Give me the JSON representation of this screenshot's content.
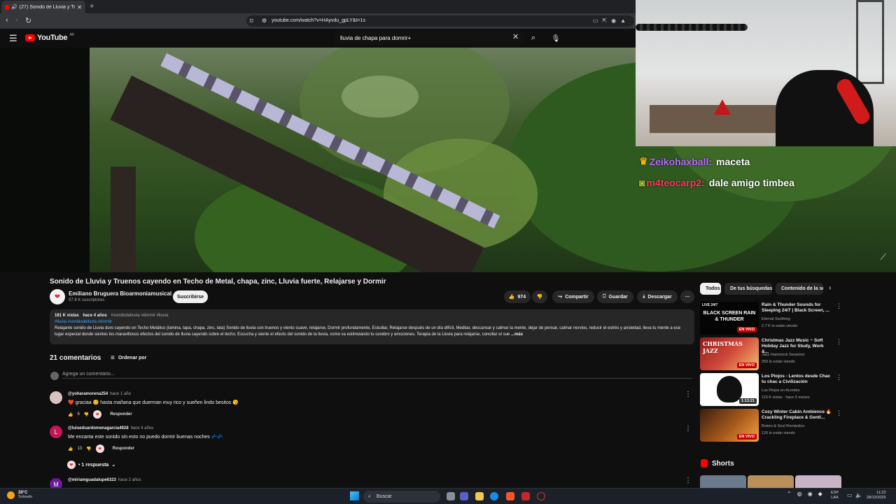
{
  "browser": {
    "tab_title": "(27) Sonido de Lluvia y Truen",
    "url": "youtube.com/watch?v=HAyvdu_gpLY&t=1s"
  },
  "youtube": {
    "logo_text": "YouTube",
    "logo_region": "AR",
    "search_value": "lluvia de chapa para domrir+"
  },
  "stream_chat": [
    {
      "user": "Zeikohaxball:",
      "message": "maceta",
      "user_color": "#b76cff"
    },
    {
      "user": "m4teocarp2:",
      "message": "dale amigo timbea",
      "user_color": "#ff3b5c"
    }
  ],
  "video": {
    "title": "Sonido de Lluvia y Truenos cayendo en Techo de Metal, chapa, zinc, Lluvia fuerte, Relajarse y Dormir",
    "channel": "Emiliano Bruguera Bioarmoniamusical",
    "subscribers": "97.8 K suscriptores",
    "subscribe_label": "Suscribirse",
    "likes": "974",
    "share_label": "Compartir",
    "save_label": "Guardar",
    "download_label": "Descargar"
  },
  "description": {
    "views": "181 K vistas",
    "age": "hace 4 años",
    "header_tags": "#sonidodelluvia #dormir #lluvia",
    "tags": "#lluvia #sonidodelluvia #dormir",
    "text": "Relajante sonido de Lluvia duro cayendo en Techo Metálico (lamina, tapa, chapa, zinc, lata) Sonido de lluvia con truenos y viento suave, relajarse, Dormir profundamente, Estudiar, Relajarse después de un día difícil, Meditar, descansar y calmar la mente, dejar de pensar, calmar nervios,  reducir el estrés y ansiedad, lleva tu mente a ese lugar especial donde sientes los maravillosos efectos del sonido de lluvia cayendo sobre el techo. Escucha y siente el efecto del sonido de la lluvia, como va estimulando tu cerebro y emociones. Terapia de la Lluvia para relajarse, conciliar el sue",
    "more_label": "...más"
  },
  "comments": {
    "count_label": "21 comentarios",
    "sort_label": "Ordenar por",
    "add_placeholder": "Agrega un comentario...",
    "reply_label": "Responder",
    "items": [
      {
        "user": "@yoharamorena254",
        "time": "hace 1 año",
        "text": "❤️ graciaa 😊 hasta mañana que duerman muy rico y sueñen lindo besitos 😘",
        "likes": "6"
      },
      {
        "user": "@luiseduardomenagarcia4928",
        "time": "hace 4 años",
        "text": "Me encanta este sonido sin esto no puedo dormir buenas noches 💤💤",
        "likes": "13"
      },
      {
        "user": "@miriamguadalupe6323",
        "time": "hace 2 años",
        "text": ""
      }
    ],
    "replies_label": "• 1 respuesta"
  },
  "sidebar": {
    "chips": [
      "Todos",
      "De tus búsquedas",
      "Contenido de la se"
    ],
    "recommendations": [
      {
        "title": "Rain & Thunder Sounds for Sleeping 24/7 | Black Screen, ...",
        "channel": "Eternal Soothing",
        "meta": "2.7 K lo están viendo",
        "badge": "EN VIVO",
        "thumb_text": "BLACK SCREEN RAIN & THUNDER",
        "thumb_corner": "LIVE 24/7"
      },
      {
        "title": "Christmas Jazz Music ~ Soft Holiday Jazz for Study, Work &...",
        "channel": "Jazz Hammock Sessions",
        "meta": "250 lo están viendo",
        "badge": "EN VIVO",
        "thumb_text": "CHRISTMAS JAZZ"
      },
      {
        "title": "Los Piojos - Lentos desde Chac tu chac a Civilización",
        "channel": "Los Piojos en Acordes",
        "meta": "110 K vistas · hace 5 meses",
        "badge": "1:13:21"
      },
      {
        "title": "Cozy Winter Cabin Ambience 🔥 Crackling Fireplace & Gentl...",
        "channel": "Bolero & Soul Romántico",
        "meta": "126 lo están viendo",
        "badge": "EN VIVO"
      }
    ],
    "shorts_label": "Shorts"
  },
  "taskbar": {
    "temperature": "28°C",
    "condition": "Soleado",
    "search_label": "Buscar",
    "lang_top": "ESP",
    "lang_bottom": "LAA",
    "time": "11:22",
    "date": "28/12/2025"
  }
}
